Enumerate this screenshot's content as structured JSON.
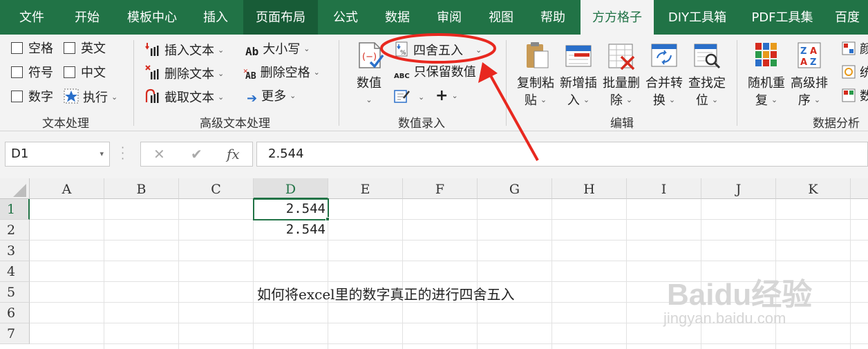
{
  "tabs": [
    {
      "label": "文件"
    },
    {
      "label": "开始"
    },
    {
      "label": "模板中心"
    },
    {
      "label": "插入"
    },
    {
      "label": "页面布局"
    },
    {
      "label": "公式"
    },
    {
      "label": "数据"
    },
    {
      "label": "审阅"
    },
    {
      "label": "视图"
    },
    {
      "label": "帮助"
    },
    {
      "label": "方方格子"
    },
    {
      "label": "DIY工具箱"
    },
    {
      "label": "PDF工具集"
    },
    {
      "label": "百度"
    }
  ],
  "ribbon": {
    "text_processing": {
      "label": "文本处理",
      "items": [
        "空格",
        "英文",
        "符号",
        "中文",
        "数字",
        "执行"
      ]
    },
    "advanced_text": {
      "label": "高级文本处理",
      "insert_text": "插入文本",
      "delete_text": "删除文本",
      "extract_text": "截取文本",
      "case": "大小写",
      "delete_spaces": "删除空格",
      "more": "更多",
      "case_icon_text": "Ab",
      "spaces_icon_text": "AB"
    },
    "numeric_entry": {
      "label": "数值录入",
      "value_button": "数值",
      "round": "四舍五入",
      "keep_values": "只保留数值",
      "abc_icon_text": "ABC",
      "plus": "+"
    },
    "edit": {
      "label": "编辑",
      "copy_paste": [
        "复制粘",
        "贴"
      ],
      "add_insert": [
        "新增插",
        "入"
      ],
      "batch_delete": [
        "批量删",
        "除"
      ],
      "merge_convert": [
        "合并转",
        "换"
      ],
      "find_locate": [
        "查找定",
        "位"
      ]
    },
    "data_analysis": {
      "label": "数据分析",
      "random_repeat": [
        "随机重",
        "复"
      ],
      "advanced_sort": [
        "高级排",
        "序"
      ],
      "partial_labels": [
        "颜",
        "统",
        "数"
      ]
    }
  },
  "formula_bar": {
    "name_box": "D1",
    "cancel": "✕",
    "enter": "✔",
    "fx": "fx",
    "value": "2.544"
  },
  "sheet": {
    "columns": [
      "A",
      "B",
      "C",
      "D",
      "E",
      "F",
      "G",
      "H",
      "I",
      "J",
      "K"
    ],
    "rows": [
      "1",
      "2",
      "3",
      "4",
      "5",
      "6",
      "7"
    ],
    "cells": {
      "D1": "2.544",
      "D2": "2.544"
    },
    "note": "如何将excel里的数字真正的进行四舍五入",
    "selected_cell": "D1"
  },
  "watermark": {
    "logo": "Baidu经验",
    "url": "jingyan.baidu.com"
  },
  "colors": {
    "excel_green": "#217346",
    "annotation_red": "#e8281f"
  },
  "icons": [
    "checkbox-icon",
    "insert-text-icon",
    "delete-text-icon",
    "extract-text-icon",
    "case-icon",
    "delete-space-icon",
    "arrow-right-icon",
    "numeric-icon",
    "round-icon",
    "abc-icon",
    "edit-icon",
    "plus-icon",
    "copy-paste-icon",
    "add-insert-icon",
    "batch-delete-icon",
    "merge-convert-icon",
    "find-locate-icon",
    "random-icon",
    "sort-icon"
  ]
}
